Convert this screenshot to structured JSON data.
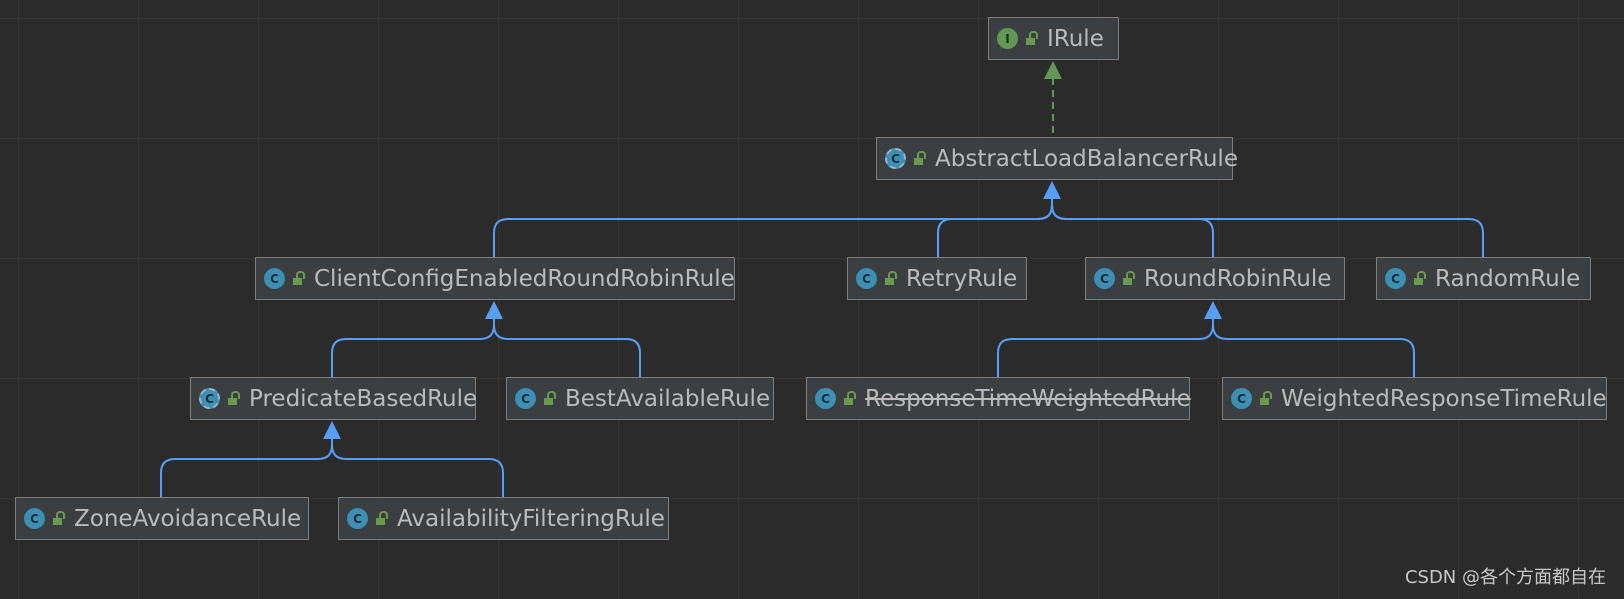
{
  "diagram": {
    "nodes": [
      {
        "id": "irule",
        "label": "IRule",
        "kind": "interface",
        "badge": "I"
      },
      {
        "id": "abstract",
        "label": "AbstractLoadBalancerRule",
        "kind": "abstract",
        "badge": "C"
      },
      {
        "id": "client",
        "label": "ClientConfigEnabledRoundRobinRule",
        "kind": "class",
        "badge": "C"
      },
      {
        "id": "retry",
        "label": "RetryRule",
        "kind": "class",
        "badge": "C"
      },
      {
        "id": "roundrobin",
        "label": "RoundRobinRule",
        "kind": "class",
        "badge": "C"
      },
      {
        "id": "random",
        "label": "RandomRule",
        "kind": "class",
        "badge": "C"
      },
      {
        "id": "predicate",
        "label": "PredicateBasedRule",
        "kind": "abstract",
        "badge": "C"
      },
      {
        "id": "best",
        "label": "BestAvailableRule",
        "kind": "class",
        "badge": "C"
      },
      {
        "id": "rtw",
        "label": "ResponseTimeWeightedRule",
        "kind": "class",
        "badge": "C",
        "deprecated": true
      },
      {
        "id": "wrt",
        "label": "WeightedResponseTimeRule",
        "kind": "class",
        "badge": "C"
      },
      {
        "id": "zone",
        "label": "ZoneAvoidanceRule",
        "kind": "class",
        "badge": "C"
      },
      {
        "id": "avail",
        "label": "AvailabilityFilteringRule",
        "kind": "class",
        "badge": "C"
      }
    ],
    "relations": [
      {
        "from": "abstract",
        "to": "irule",
        "type": "implements"
      },
      {
        "from": "client",
        "to": "abstract",
        "type": "extends"
      },
      {
        "from": "retry",
        "to": "abstract",
        "type": "extends"
      },
      {
        "from": "roundrobin",
        "to": "abstract",
        "type": "extends"
      },
      {
        "from": "random",
        "to": "abstract",
        "type": "extends"
      },
      {
        "from": "predicate",
        "to": "client",
        "type": "extends"
      },
      {
        "from": "best",
        "to": "client",
        "type": "extends"
      },
      {
        "from": "rtw",
        "to": "roundrobin",
        "type": "extends"
      },
      {
        "from": "wrt",
        "to": "roundrobin",
        "type": "extends"
      },
      {
        "from": "zone",
        "to": "predicate",
        "type": "extends"
      },
      {
        "from": "avail",
        "to": "predicate",
        "type": "extends"
      }
    ],
    "colors": {
      "extends": "#589df6",
      "implements": "#629755"
    }
  },
  "watermark": "CSDN @各个方面都自在"
}
